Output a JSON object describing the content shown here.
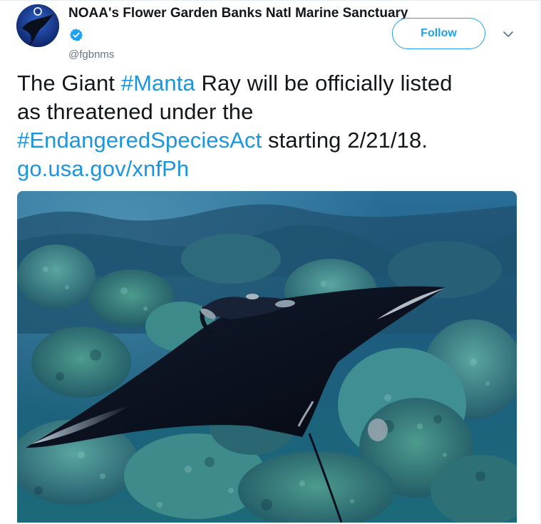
{
  "tweet": {
    "author": {
      "display_name": "NOAA's Flower Garden Banks Natl Marine Sanctuary",
      "handle": "@fgbnms",
      "verified": true,
      "avatar_icon": "manta-ray-avatar"
    },
    "follow_button_label": "Follow",
    "menu_icon": "chevron-down-icon",
    "text": {
      "line1_prefix": "The Giant ",
      "line1_hashtag": "#Manta",
      "line1_suffix": " Ray will be officially listed",
      "line2": "as threatened under the",
      "line3_hashtag": "#EndangeredSpeciesAct",
      "line3_suffix": " starting 2/21/18.",
      "link": "go.usa.gov/xnfPh"
    },
    "media": {
      "type": "photo",
      "subject": "manta-ray-over-coral-reef"
    }
  },
  "colors": {
    "accent": "#1da1f2",
    "hashtag": "#1b95e0",
    "text": "#14171a",
    "muted": "#657786",
    "verified": "#1da1f2"
  }
}
